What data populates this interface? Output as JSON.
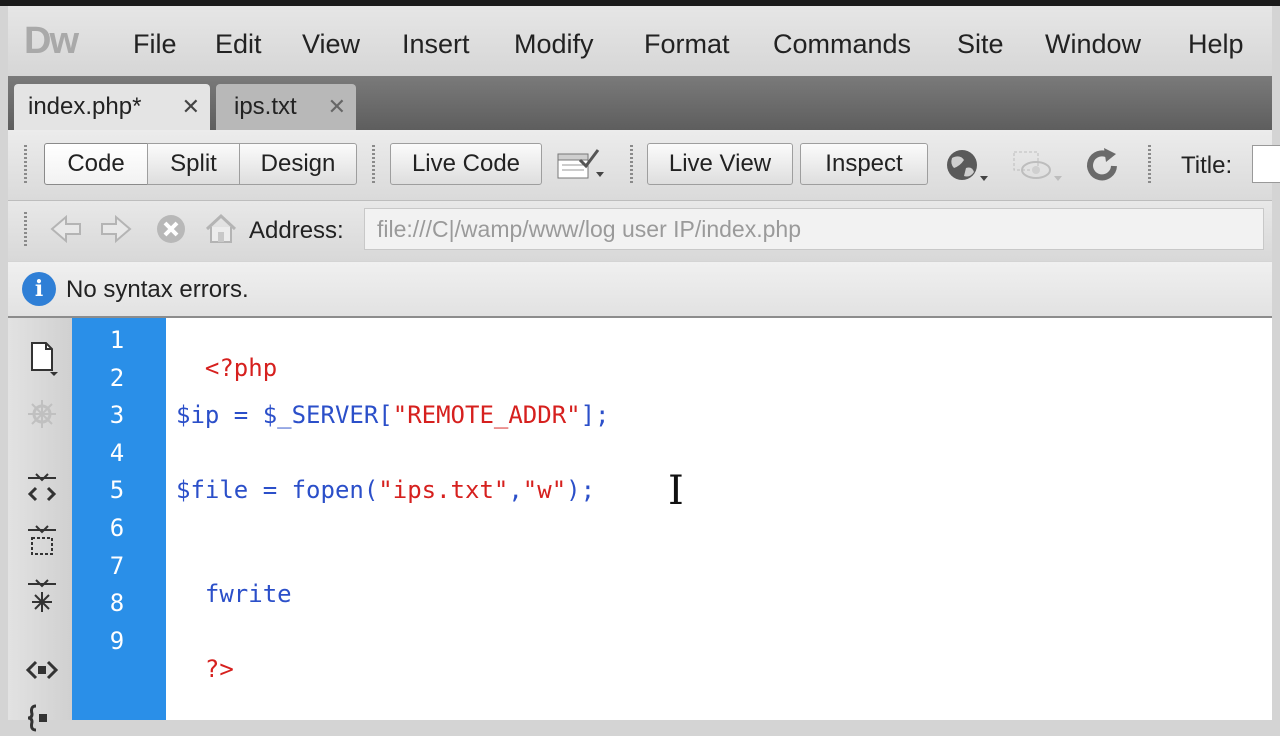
{
  "app": {
    "logo": "Dw"
  },
  "menu": [
    "File",
    "Edit",
    "View",
    "Insert",
    "Modify",
    "Format",
    "Commands",
    "Site",
    "Window",
    "Help"
  ],
  "tabs": [
    {
      "label": "index.php*",
      "active": true
    },
    {
      "label": "ips.txt",
      "active": false
    }
  ],
  "doc_toolbar": {
    "view_buttons": [
      "Code",
      "Split",
      "Design"
    ],
    "active_view": "Code",
    "live_code": "Live Code",
    "live_view": "Live View",
    "inspect": "Inspect",
    "title_label": "Title:"
  },
  "nav_toolbar": {
    "address_label": "Address:",
    "address_value": "file:///C|/wamp/www/log user IP/index.php"
  },
  "status": {
    "message": "No syntax errors."
  },
  "editor": {
    "line_numbers": [
      "1",
      "2",
      "3",
      "4",
      "5",
      "6",
      "7",
      "8",
      "9"
    ],
    "lines": {
      "l1": "<?php",
      "l3a": "$ip = $_SERVER[",
      "l3b": "\"REMOTE_ADDR\"",
      "l3c": "];",
      "l5a": "$file = fopen(",
      "l5b": "\"ips.txt\"",
      "l5c": ",",
      "l5d": "\"w\"",
      "l5e": ");",
      "l7": "fwrite",
      "l9": "?>"
    }
  },
  "colors": {
    "gutter": "#2a8fe8",
    "php_tag": "#d6201e",
    "keyword": "#2b4fc9",
    "string": "#d6201e"
  },
  "icons": [
    "back-arrow-icon",
    "forward-arrow-icon",
    "stop-icon",
    "home-icon",
    "file-management-icon",
    "preview-globe-icon",
    "visual-aids-icon",
    "refresh-icon",
    "info-icon",
    "open-documents-icon",
    "collapse-tag-icon",
    "collapse-selection-icon",
    "expand-all-icon",
    "select-parent-tag-icon",
    "balance-braces-icon"
  ]
}
